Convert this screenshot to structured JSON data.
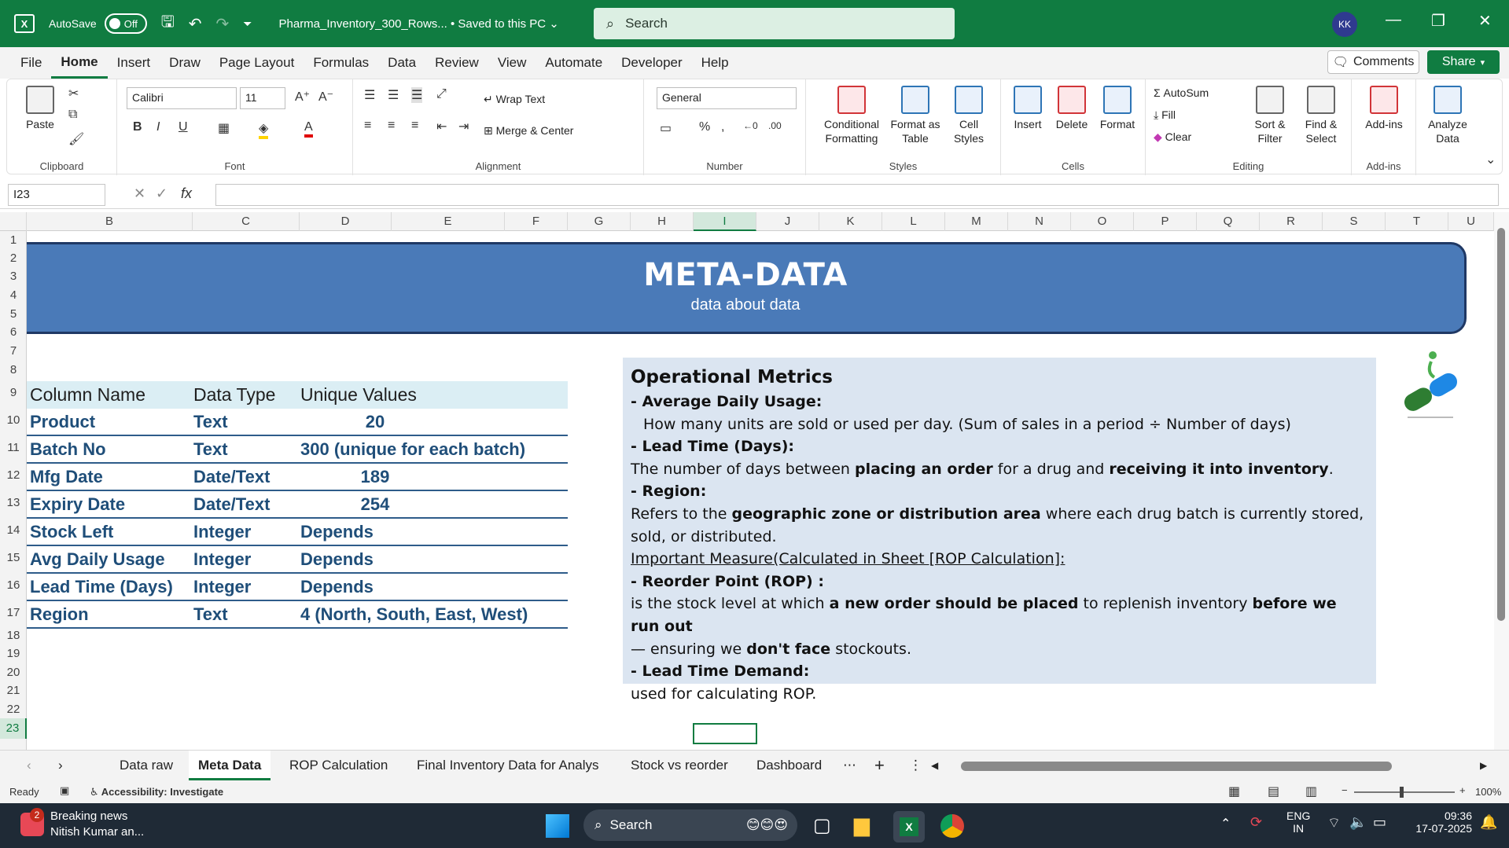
{
  "titlebar": {
    "autosave_label": "AutoSave",
    "autosave_state": "Off",
    "document_title": "Pharma_Inventory_300_Rows... • Saved to this PC ⌄",
    "search_placeholder": "Search",
    "user_initials": "KK"
  },
  "menu": {
    "tabs": [
      "File",
      "Home",
      "Insert",
      "Draw",
      "Page Layout",
      "Formulas",
      "Data",
      "Review",
      "View",
      "Automate",
      "Developer",
      "Help"
    ],
    "active": "Home",
    "comments_label": "Comments",
    "share_label": "Share"
  },
  "ribbon": {
    "clipboard": {
      "paste": "Paste",
      "label": "Clipboard"
    },
    "font": {
      "name": "Calibri",
      "size": "11",
      "label": "Font"
    },
    "alignment": {
      "wrap": "Wrap Text",
      "merge": "Merge & Center",
      "label": "Alignment"
    },
    "number": {
      "format": "General",
      "label": "Number"
    },
    "styles": {
      "conditional": "Conditional Formatting",
      "format_table": "Format as Table",
      "cell_styles": "Cell Styles",
      "label": "Styles"
    },
    "cells": {
      "insert": "Insert",
      "delete": "Delete",
      "format": "Format",
      "label": "Cells"
    },
    "editing": {
      "autosum": "AutoSum",
      "fill": "Fill",
      "clear": "Clear",
      "sort": "Sort & Filter",
      "find": "Find & Select",
      "label": "Editing"
    },
    "addins": {
      "addins": "Add-ins",
      "label": "Add-ins"
    },
    "analyze": {
      "label": "Analyze Data"
    }
  },
  "formula_bar": {
    "name_box": "I23",
    "fx": "fx",
    "value": ""
  },
  "grid": {
    "columns": [
      "B",
      "C",
      "D",
      "E",
      "F",
      "G",
      "H",
      "I",
      "J",
      "K",
      "L",
      "M",
      "N",
      "O",
      "P",
      "Q",
      "R",
      "S",
      "T",
      "U"
    ],
    "active_column": "I",
    "rows": [
      "1",
      "2",
      "3",
      "4",
      "5",
      "6",
      "7",
      "8",
      "9",
      "10",
      "11",
      "12",
      "13",
      "14",
      "15",
      "16",
      "17",
      "18",
      "19",
      "20",
      "21",
      "22",
      "23"
    ],
    "active_row": "23"
  },
  "banner": {
    "title": "META-DATA",
    "subtitle": "data about data"
  },
  "metatable": {
    "headers": [
      "Column Name",
      "Data Type",
      "Unique Values"
    ],
    "rows": [
      {
        "name": "Product",
        "type": "Text",
        "unique": "20"
      },
      {
        "name": "Batch No",
        "type": "Text",
        "unique": "300 (unique for each batch)"
      },
      {
        "name": "Mfg Date",
        "type": "Date/Text",
        "unique": "189"
      },
      {
        "name": "Expiry Date",
        "type": "Date/Text",
        "unique": "254"
      },
      {
        "name": "Stock Left",
        "type": "Integer",
        "unique": "Depends"
      },
      {
        "name": "Avg Daily Usage",
        "type": "Integer",
        "unique": "Depends"
      },
      {
        "name": "Lead Time (Days)",
        "type": "Integer",
        "unique": "Depends"
      },
      {
        "name": "Region",
        "type": "Text",
        "unique": "4 (North, South, East, West)"
      }
    ]
  },
  "operational": {
    "heading": "Operational Metrics",
    "avg_head": "- Average Daily Usage:",
    "avg_text": "How many units are sold or used per day. (Sum of sales in a period ÷ Number of days)",
    "lead_head": "- Lead Time (Days):",
    "lead_pre": "The number of days between ",
    "lead_b1": "placing an order",
    "lead_mid": " for a drug and ",
    "lead_b2": "receiving it into inventory",
    "lead_end": ".",
    "region_head": "- Region:",
    "region_pre": "Refers to the ",
    "region_b": "geographic zone or distribution area",
    "region_post": " where each drug batch is currently stored,",
    "region_line2": "sold, or distributed.",
    "important": "Important Measure(Calculated in Sheet [ROP Calculation]:",
    "rop_head": "- Reorder Point (ROP) :",
    "rop_pre": "is the stock level at which ",
    "rop_b1": "a new order should be placed",
    "rop_mid": " to replenish inventory ",
    "rop_b2": "before we run out",
    "rop_line2_pre": "— ensuring we ",
    "rop_b3": "don't face",
    "rop_line2_post": " stockouts.",
    "ltd_head": "- Lead Time Demand:",
    "ltd_text": "used for calculating ROP."
  },
  "sheets": {
    "tabs": [
      "Data raw",
      "Meta Data",
      "ROP Calculation",
      "Final Inventory Data for Analys",
      "Stock vs reorder",
      "Dashboard"
    ],
    "active": "Meta Data"
  },
  "status": {
    "ready": "Ready",
    "accessibility": "Accessibility: Investigate",
    "zoom": "100%"
  },
  "taskbar": {
    "news_title": "Breaking news",
    "news_sub": "Nitish Kumar an...",
    "news_badge": "2",
    "search": "Search",
    "lang1": "ENG",
    "lang2": "IN",
    "time": "09:36",
    "date": "17-07-2025"
  },
  "colors": {
    "excel_green": "#107c41",
    "banner_blue": "#4a7ab8",
    "table_blue": "#1f4e79",
    "box_bg": "#dbe5f1"
  }
}
